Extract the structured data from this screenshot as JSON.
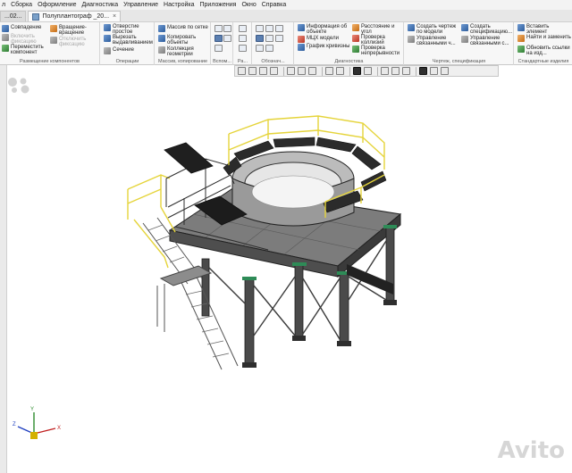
{
  "menu": {
    "items": [
      "л",
      "Сборка",
      "Оформление",
      "Диагностика",
      "Управление",
      "Настройка",
      "Приложения",
      "Окно",
      "Справка"
    ]
  },
  "tabs": [
    {
      "label": "...02..."
    },
    {
      "label": "Полуплантограф _20..."
    }
  ],
  "ribbon": {
    "group1": {
      "caption": "Размещение компонентов",
      "btn_match": "Совпадение",
      "btn_rotate": "Вращение-вращение",
      "btn_include": "Включить фиксацию",
      "btn_exclude": "Отключить фиксацию",
      "btn_move": "Переместить компонент"
    },
    "group2": {
      "caption": "Операции",
      "btn_hole": "Отверстие простое",
      "btn_extrude_cut": "Вырезать выдавливанием",
      "btn_section": "Сечение"
    },
    "group3": {
      "caption": "Массив, копирование",
      "btn_grid": "Массив по сетке",
      "btn_copy": "Копировать объекты",
      "btn_collection": "Коллекция геометрии"
    },
    "group4": {
      "caption": "Вспом..."
    },
    "group5": {
      "caption": "Ра..."
    },
    "group6": {
      "caption": "Обознач..."
    },
    "group7": {
      "caption": "Диагностика",
      "btn_info": "Информация об объекте",
      "btn_mcx": "МЦХ модели",
      "btn_graph": "График кривизны",
      "btn_distance": "Расстояние и угол",
      "btn_collisions": "Проверка коллизий",
      "btn_continuity": "Проверка непрерывности"
    },
    "group8": {
      "caption": "Чертеж, спецификация",
      "btn_drawing": "Создать чертеж по модели",
      "btn_manage": "Управление связанными ч...",
      "btn_spec": "Создать спецификацию...",
      "btn_manage2": "Управление связанными с..."
    },
    "group9": {
      "caption": "Стандартные изделия",
      "btn_insert": "Вставить элемент",
      "btn_find": "Найти и заменить",
      "btn_update": "Обновить ссылки на изд..."
    }
  },
  "viewport": {
    "axis_x": "X",
    "axis_y": "Y",
    "axis_z": "Z"
  },
  "watermark": "Avito",
  "colors": {
    "structure": "#5c5c5c",
    "railing": "#e5d43a",
    "steel_dark": "#2d2d2d",
    "accent_green": "#2e8b57"
  }
}
